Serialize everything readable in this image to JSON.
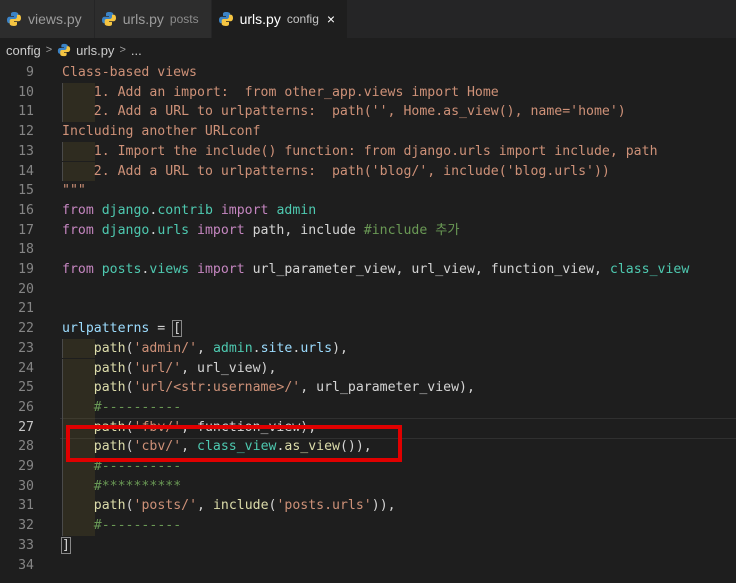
{
  "tabs": [
    {
      "name": "views.py",
      "desc": "",
      "active": false
    },
    {
      "name": "urls.py",
      "desc": "posts",
      "active": false
    },
    {
      "name": "urls.py",
      "desc": "config",
      "active": true,
      "close": "×"
    }
  ],
  "breadcrumb": {
    "folder": "config",
    "file": "urls.py",
    "more": "..."
  },
  "colors": {
    "highlight_box": "#e00000",
    "background": "#1e1e1e"
  },
  "editor": {
    "current_line": "27",
    "lines": [
      {
        "num": "9",
        "parts": [
          [
            "Class-based views",
            "s"
          ]
        ]
      },
      {
        "num": "10",
        "parts": [
          [
            "1. Add an import:  from other_app.views import Home",
            "s"
          ]
        ]
      },
      {
        "num": "11",
        "parts": [
          [
            "2. Add a URL to urlpatterns:  path('', Home.as_view(), name='home')",
            "s"
          ]
        ]
      },
      {
        "num": "12",
        "parts": [
          [
            "Including another URLconf",
            "s"
          ]
        ]
      },
      {
        "num": "13",
        "parts": [
          [
            "1. Import the include() function: from django.urls import include, path",
            "s"
          ]
        ]
      },
      {
        "num": "14",
        "parts": [
          [
            "2. Add a URL to urlpatterns:  path('blog/', include('blog.urls'))",
            "s"
          ]
        ]
      },
      {
        "num": "15",
        "parts": [
          [
            "\"\"\"",
            "s"
          ]
        ]
      },
      {
        "num": "16",
        "parts": [
          [
            "from",
            "k"
          ],
          [
            " ",
            "w"
          ],
          [
            "django",
            "m"
          ],
          [
            ".",
            "w"
          ],
          [
            "contrib",
            "m"
          ],
          [
            " ",
            "w"
          ],
          [
            "import",
            "k"
          ],
          [
            " ",
            "w"
          ],
          [
            "admin",
            "m"
          ]
        ]
      },
      {
        "num": "17",
        "parts": [
          [
            "from",
            "k"
          ],
          [
            " ",
            "w"
          ],
          [
            "django",
            "m"
          ],
          [
            ".",
            "w"
          ],
          [
            "urls",
            "m"
          ],
          [
            " ",
            "w"
          ],
          [
            "import",
            "k"
          ],
          [
            " path, include ",
            "w"
          ],
          [
            "#include 추가",
            "c"
          ]
        ]
      },
      {
        "num": "18",
        "parts": []
      },
      {
        "num": "19",
        "parts": [
          [
            "from",
            "k"
          ],
          [
            " ",
            "w"
          ],
          [
            "posts",
            "m"
          ],
          [
            ".",
            "w"
          ],
          [
            "views",
            "m"
          ],
          [
            " ",
            "w"
          ],
          [
            "import",
            "k"
          ],
          [
            " url_parameter_view, url_view, function_view, ",
            "w"
          ],
          [
            "class_view",
            "m"
          ]
        ]
      },
      {
        "num": "20",
        "parts": []
      },
      {
        "num": "21",
        "parts": []
      },
      {
        "num": "22",
        "parts": [
          [
            "urlpatterns",
            "v"
          ],
          [
            " = ",
            "w"
          ],
          [
            "[",
            "w"
          ]
        ]
      },
      {
        "num": "23",
        "parts": [
          [
            "path",
            "f"
          ],
          [
            "(",
            "w"
          ],
          [
            "'admin/'",
            "s"
          ],
          [
            ", ",
            "w"
          ],
          [
            "admin",
            "m"
          ],
          [
            ".",
            "w"
          ],
          [
            "site",
            "v"
          ],
          [
            ".",
            "w"
          ],
          [
            "urls",
            "v"
          ],
          [
            "),",
            "w"
          ]
        ]
      },
      {
        "num": "24",
        "parts": [
          [
            "path",
            "f"
          ],
          [
            "(",
            "w"
          ],
          [
            "'url/'",
            "s"
          ],
          [
            ", url_view),",
            "w"
          ]
        ]
      },
      {
        "num": "25",
        "parts": [
          [
            "path",
            "f"
          ],
          [
            "(",
            "w"
          ],
          [
            "'url/<str:username>/'",
            "s"
          ],
          [
            ", url_parameter_view),",
            "w"
          ]
        ]
      },
      {
        "num": "26",
        "parts": [
          [
            "#----------",
            "c"
          ]
        ]
      },
      {
        "num": "27",
        "parts": [
          [
            "path",
            "f"
          ],
          [
            "(",
            "w"
          ],
          [
            "'fbv/'",
            "s"
          ],
          [
            ", function_view),",
            "w"
          ]
        ]
      },
      {
        "num": "28",
        "parts": [
          [
            "path",
            "f"
          ],
          [
            "(",
            "w"
          ],
          [
            "'cbv/'",
            "s"
          ],
          [
            ", ",
            "w"
          ],
          [
            "class_view",
            "m"
          ],
          [
            ".",
            "w"
          ],
          [
            "as_view",
            "f"
          ],
          [
            "()),",
            "w"
          ]
        ]
      },
      {
        "num": "29",
        "parts": [
          [
            "#----------",
            "c"
          ]
        ]
      },
      {
        "num": "30",
        "parts": [
          [
            "#**********",
            "c"
          ]
        ]
      },
      {
        "num": "31",
        "parts": [
          [
            "path",
            "f"
          ],
          [
            "(",
            "w"
          ],
          [
            "'posts/'",
            "s"
          ],
          [
            ", ",
            "w"
          ],
          [
            "include",
            "f"
          ],
          [
            "(",
            "w"
          ],
          [
            "'posts.urls'",
            "s"
          ],
          [
            ")),",
            "w"
          ]
        ]
      },
      {
        "num": "32",
        "parts": [
          [
            "#----------",
            "c"
          ]
        ]
      },
      {
        "num": "33",
        "parts": [
          [
            "]",
            "w"
          ]
        ]
      },
      {
        "num": "34",
        "parts": []
      }
    ]
  }
}
